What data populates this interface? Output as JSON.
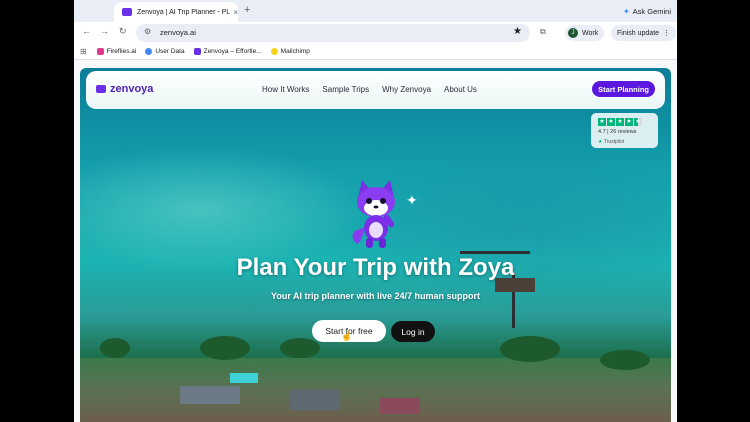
{
  "browser": {
    "tab_title": "Zenvoya | AI Trip Planner - PL",
    "tab_close": "×",
    "new_tab": "+",
    "ask_gemini": "Ask Gemini",
    "url": "zenvoya.ai",
    "profile_initial": "J",
    "profile_name": "Work",
    "finish_update": "Finish update",
    "bookmarks": [
      {
        "label": "Fireflies.ai",
        "color": "#e0398d"
      },
      {
        "label": "User Data",
        "color": "#4285f4"
      },
      {
        "label": "Zenvoya – Effortle...",
        "color": "#6a2fe8"
      },
      {
        "label": "Mailchimp",
        "color": "#f7d117"
      }
    ]
  },
  "site": {
    "logo": "zenvoya",
    "nav": [
      "How It Works",
      "Sample Trips",
      "Why Zenvoya",
      "About Us"
    ],
    "cta": "Start Planning",
    "trustpilot": {
      "rating": "4.7 | 26 reviews",
      "brand": "Trustpilot",
      "stars": 4.5
    },
    "headline": "Plan Your Trip with Zoya",
    "subheadline": "Your AI trip planner with live 24/7 human support",
    "primary_button": "Start for free",
    "secondary_button": "Log in"
  },
  "colors": {
    "brand": "#5b16e0",
    "trust_green": "#00b67a"
  }
}
